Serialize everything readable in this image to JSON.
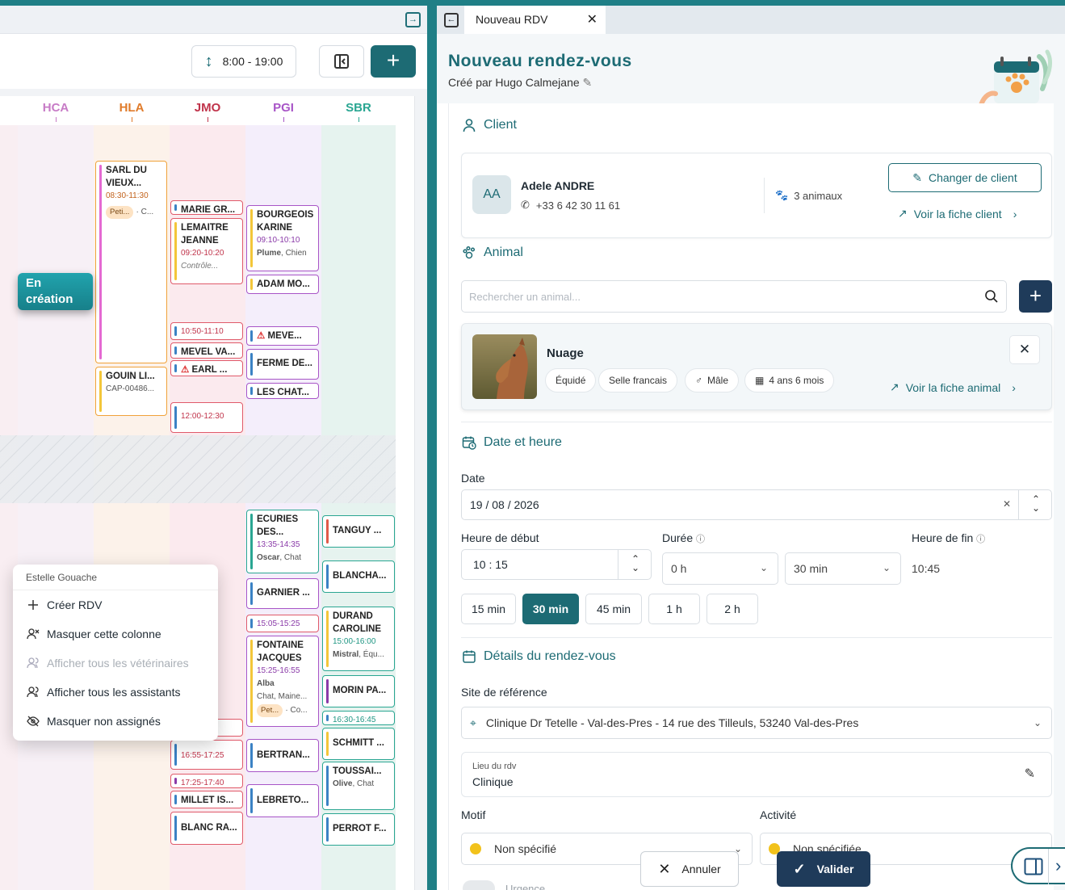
{
  "left": {
    "hours_range": "8:00  -  19:00",
    "columns": [
      {
        "code": "HCA",
        "color": "#c77bc6"
      },
      {
        "code": "HLA",
        "color": "#e07b2a"
      },
      {
        "code": "JMO",
        "color": "#c0334a"
      },
      {
        "code": "PGI",
        "color": "#a855c7"
      },
      {
        "code": "SBR",
        "color": "#2aa692"
      }
    ],
    "en_creation": "En création",
    "events": {
      "hla": [
        {
          "title": "SARL DU VIEUX...",
          "time": "08:30-11:30",
          "tag": "Peti...",
          "tail": "· C..."
        },
        {
          "title": "GOUIN LI...",
          "sub": "CAP-00486..."
        }
      ],
      "jmo": [
        {
          "title": "MARIE GR..."
        },
        {
          "title": "LEMAITRE JEANNE",
          "time": "09:20-10:20",
          "italic": "Contrôle..."
        },
        {
          "time": "10:50-11:10"
        },
        {
          "title": "MEVEL VA..."
        },
        {
          "title": "EARL ..."
        },
        {
          "time": "12:00-12:30"
        },
        {
          "title": "... E..."
        },
        {
          "time": "16:55-17:25"
        },
        {
          "time": "17:25-17:40"
        },
        {
          "title": "MILLET IS..."
        },
        {
          "title": "BLANC RA..."
        }
      ],
      "pgi": [
        {
          "title": "BOURGEOIS KARINE",
          "time": "09:10-10:10",
          "sub_bold": "Plume",
          "sub": ", Chien"
        },
        {
          "title": "ADAM MO..."
        },
        {
          "title": "MEVE..."
        },
        {
          "title": "FERME DE..."
        },
        {
          "title": "LES CHAT..."
        },
        {
          "title": "ECURIES DES...",
          "time": "13:35-14:35",
          "sub_bold": "Oscar",
          "sub": ", Chat"
        },
        {
          "title": "GARNIER ..."
        },
        {
          "time": "15:05-15:25"
        },
        {
          "title": "FONTAINE JACQUES",
          "time": "15:25-16:55",
          "sub_bold": "Alba",
          "sub2": "Chat, Maine...",
          "tag": "Pet...",
          "tail": "· Co..."
        },
        {
          "title": "BERTRAN..."
        },
        {
          "title": "LEBRETO..."
        }
      ],
      "sbr": [
        {
          "title": "TANGUY ..."
        },
        {
          "title": "BLANCHA..."
        },
        {
          "title": "DURAND CAROLINE",
          "time": "15:00-16:00",
          "sub_bold": "Mistral",
          "sub": ", Équ..."
        },
        {
          "title": "MORIN PA..."
        },
        {
          "time": "16:30-16:45"
        },
        {
          "title": "SCHMITT ..."
        },
        {
          "title": "TOUSSAI...",
          "sub_bold": "Olive",
          "sub": ", Chat"
        },
        {
          "title": "PERROT F..."
        }
      ]
    },
    "menu": {
      "header": "Estelle Gouache",
      "items": [
        {
          "label": "Créer RDV",
          "disabled": false
        },
        {
          "label": "Masquer cette colonne",
          "disabled": false
        },
        {
          "label": "Afficher tous les vétérinaires",
          "disabled": true
        },
        {
          "label": "Afficher tous les assistants",
          "disabled": false
        },
        {
          "label": "Masquer non assignés",
          "disabled": false
        }
      ]
    }
  },
  "right": {
    "tab_label": "Nouveau RDV",
    "title": "Nouveau rendez-vous",
    "created_by": "Créé par Hugo Calmejane",
    "client": {
      "section": "Client",
      "initials": "AA",
      "name": "Adele ANDRE",
      "phone": "+33 6 42 30 11 61",
      "animals": "3 animaux",
      "change_btn": "Changer de client",
      "view_link": "Voir la fiche client"
    },
    "animal": {
      "section": "Animal",
      "search_placeholder": "Rechercher un animal...",
      "name": "Nuage",
      "chips": [
        "Équidé",
        "Selle francais",
        "Mâle",
        "4 ans 6 mois"
      ],
      "view_link": "Voir la fiche animal"
    },
    "datetime": {
      "section": "Date et heure",
      "date_label": "Date",
      "date_value": "19 / 08 / 2026",
      "start_label": "Heure de début",
      "start_value": "10 : 15",
      "duration_label": "Durée",
      "duration_hours": "0 h",
      "duration_minutes": "30 min",
      "end_label": "Heure de fin",
      "end_value": "10:45",
      "presets": [
        "15 min",
        "30 min",
        "45 min",
        "1 h",
        "2 h"
      ],
      "selected_preset": "30 min"
    },
    "details": {
      "section": "Détails du rendez-vous",
      "site_label": "Site de référence",
      "site_value": "Clinique Dr Tetelle - Val-des-Pres - 14 rue des Tilleuls, 53240 Val-des-Pres",
      "lieu_label": "Lieu du rdv",
      "lieu_value": "Clinique",
      "motif_label": "Motif",
      "motif_value": "Non spécifié",
      "activite_label": "Activité",
      "activite_value": "Non spécifiée",
      "urgence_label": "Urgence"
    },
    "footer": {
      "cancel": "Annuler",
      "validate": "Valider"
    }
  }
}
